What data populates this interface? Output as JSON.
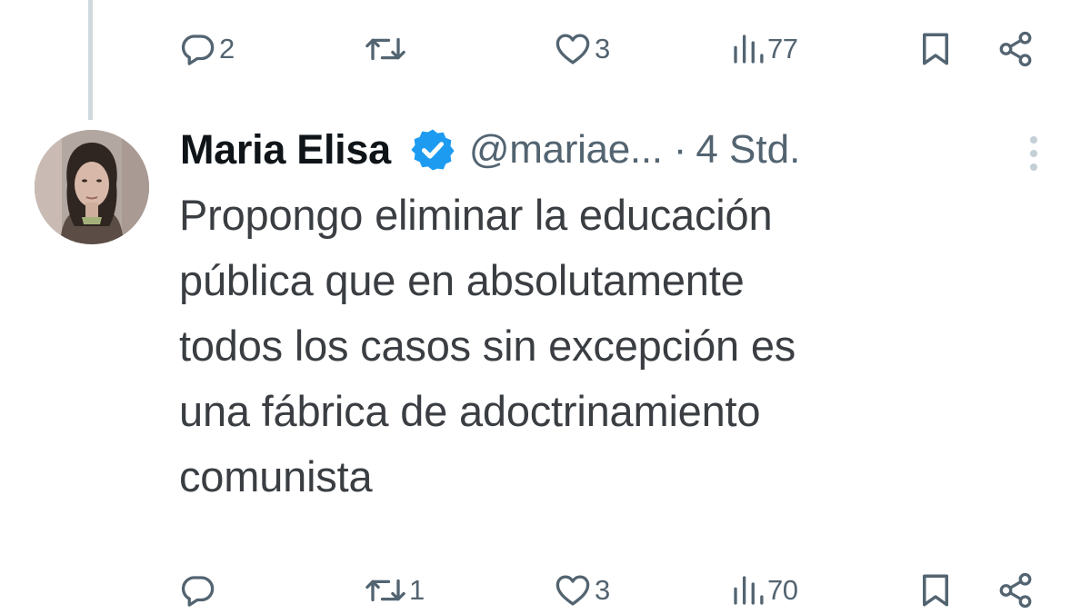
{
  "parent_actions": {
    "reply_count": "2",
    "retweet_count": "",
    "like_count": "3",
    "views_count": "77"
  },
  "tweet": {
    "author_name": "Maria Elisa",
    "handle": "@mariae...",
    "separator": "·",
    "time": "4 Std.",
    "text": "Propongo eliminar la educación\npública que en absolutamente\ntodos los casos sin excepción es\nuna fábrica de adoctrinamiento\ncomunista",
    "verified_color": "#1d9bf0"
  },
  "tweet_actions": {
    "reply_count": "",
    "retweet_count": "1",
    "like_count": "3",
    "views_count": "70"
  },
  "icons": {
    "reply": "reply-icon",
    "retweet": "retweet-icon",
    "like": "heart-icon",
    "views": "views-icon",
    "bookmark": "bookmark-icon",
    "share": "share-icon",
    "more": "more-options-icon",
    "verified": "verified-badge-icon"
  }
}
